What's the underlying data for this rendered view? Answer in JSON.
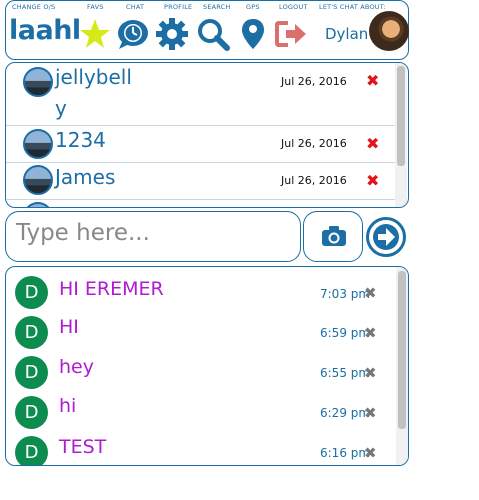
{
  "nav": {
    "labels": [
      "CHANGE O/S",
      "FAVS",
      "CHAT",
      "PROFILE",
      "SEARCH",
      "GPS",
      "LOGOUT",
      "LET'S CHAT ABOUT:"
    ],
    "logo": "laahl",
    "user_name": "Dylan",
    "icons": [
      "star-icon",
      "chat-clock-icon",
      "gear-icon",
      "search-icon",
      "map-pin-icon",
      "logout-icon"
    ]
  },
  "contacts": [
    {
      "name": "jellybell",
      "name_wrap": "y",
      "date": "Jul 26, 2016",
      "delete": "✖"
    },
    {
      "name": "1234",
      "date": "Jul 26, 2016",
      "delete": "✖"
    },
    {
      "name": "James",
      "date": "Jul 26, 2016",
      "delete": "✖"
    }
  ],
  "compose": {
    "placeholder": "Type here...",
    "camera_icon": "camera-icon",
    "send_icon": "arrow-right-circle-icon"
  },
  "messages": [
    {
      "avatar": "D",
      "text": "HI EREMER",
      "time": "7:03 pm"
    },
    {
      "avatar": "D",
      "text": "HI",
      "time": "6:59 pm"
    },
    {
      "avatar": "D",
      "text": "hey",
      "time": "6:55 pm"
    },
    {
      "avatar": "D",
      "text": "hi",
      "time": "6:29 pm"
    },
    {
      "avatar": "D",
      "text": "TEST",
      "time": "6:16 pm"
    }
  ],
  "colors": {
    "accent": "#1c6ea4",
    "star": "#d6ea17",
    "delete_red": "#e4141b",
    "message_text": "#b01bd1",
    "avatar_green": "#0c8c4e",
    "logout": "#d9706e"
  }
}
